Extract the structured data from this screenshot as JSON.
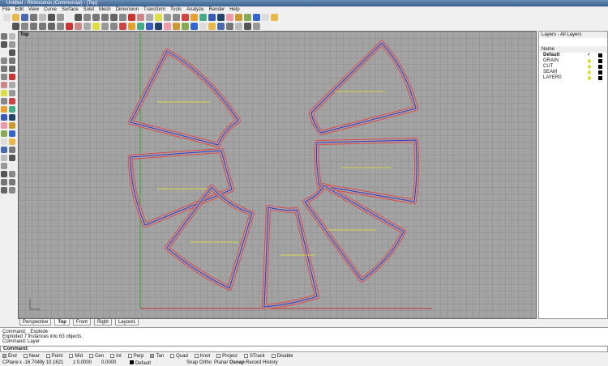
{
  "window": {
    "title": "Untitled - Rhinoceros (Commercial) - [Top]"
  },
  "menu": [
    "File",
    "Edit",
    "View",
    "Curve",
    "Surface",
    "Solid",
    "Mesh",
    "Dimension",
    "Transform",
    "Tools",
    "Analyze",
    "Render",
    "Help"
  ],
  "viewport": {
    "title": "Top"
  },
  "tabs": [
    "Perspective",
    "Top",
    "Front",
    "Right",
    "Layout1"
  ],
  "layers": {
    "title": "Layers - All Layers",
    "column": "Name",
    "items": [
      {
        "name": "Default",
        "current": true
      },
      {
        "name": "GRAIN"
      },
      {
        "name": "CUT"
      },
      {
        "name": "SEAM"
      },
      {
        "name": "LAYER0"
      }
    ],
    "current_mark": "✓"
  },
  "command_history": [
    "Command: _Explode",
    "Exploded 7 instances into 63 objects.",
    "Command: Layer"
  ],
  "command_prompt": "Command:",
  "osnaps": [
    {
      "label": "End",
      "on": true
    },
    {
      "label": "Near",
      "on": false
    },
    {
      "label": "Point",
      "on": false
    },
    {
      "label": "Mid",
      "on": false
    },
    {
      "label": "Cen",
      "on": false
    },
    {
      "label": "Int",
      "on": false
    },
    {
      "label": "Perp",
      "on": false
    },
    {
      "label": "Tan",
      "on": true
    },
    {
      "label": "Quad",
      "on": false
    },
    {
      "label": "Knot",
      "on": false
    },
    {
      "label": "Project",
      "on": false
    },
    {
      "label": "STrack",
      "on": false
    },
    {
      "label": "Disable",
      "on": false
    }
  ],
  "status": {
    "cplane": "CPlane",
    "x": "x -16.7049",
    "y": "y 10.1621",
    "z": "z 0.0000",
    "w": "0.0000",
    "layer": "Default",
    "snap": "Snap",
    "ortho": "Ortho",
    "planar": "Planar",
    "osnap": "Osnap",
    "history": "Record History"
  },
  "colors": {
    "curve_outer": "#e04848",
    "curve_inner": "#3434c8",
    "grain": "#e8e830",
    "x_axis": "#c03030",
    "y_axis": "#30a030"
  }
}
